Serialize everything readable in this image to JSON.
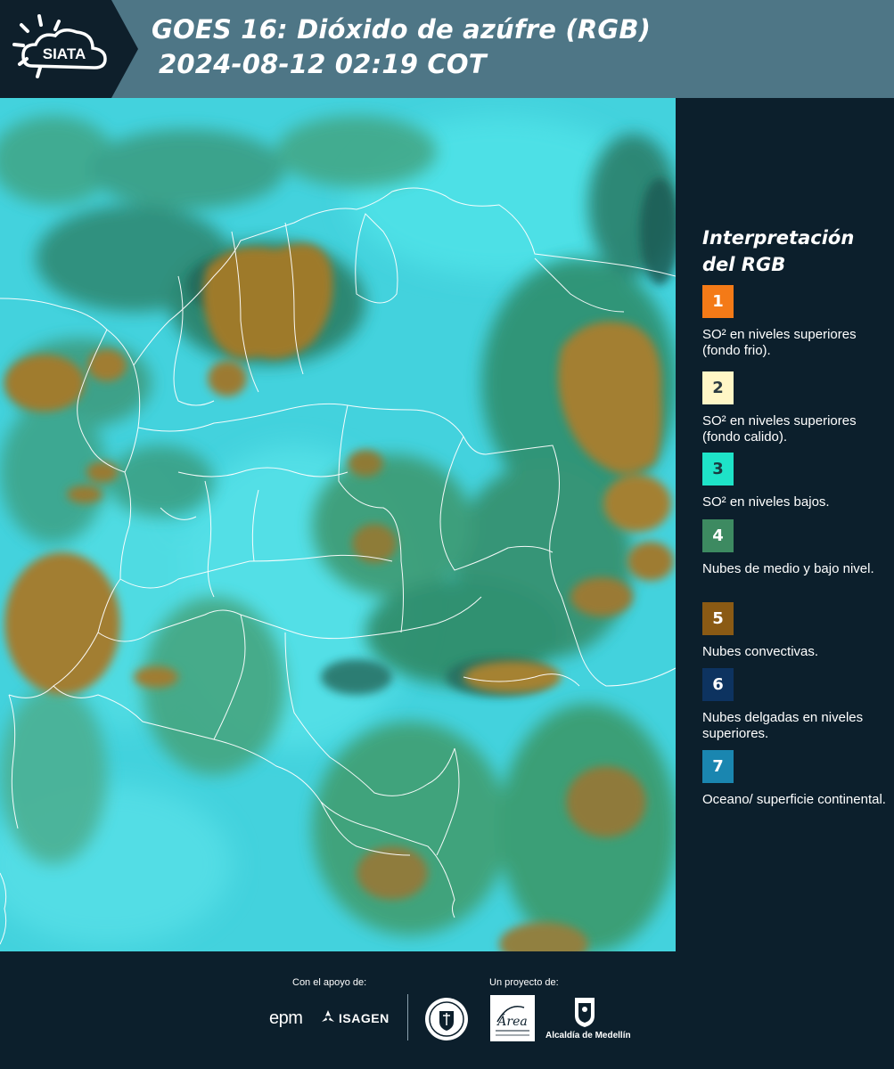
{
  "header": {
    "brand": "SIATA",
    "title_line1": "GOES 16: Dióxido de azúfre (RGB)",
    "title_line2": "2024-08-12 02:19 COT"
  },
  "legend": {
    "title_line1": "Interpretación",
    "title_line2": "del RGB",
    "items": [
      {
        "num": "1",
        "color": "#f47a17",
        "num_color": "#ffffff",
        "label": "SO² en niveles superiores (fondo frio)."
      },
      {
        "num": "2",
        "color": "#fff6c6",
        "num_color": "#2b3a40",
        "label": "SO² en niveles superiores (fondo calido)."
      },
      {
        "num": "3",
        "color": "#1ee3c8",
        "num_color": "#1a3a40",
        "label": "SO² en niveles bajos."
      },
      {
        "num": "4",
        "color": "#3d8a61",
        "num_color": "#ffffff",
        "label": "Nubes de medio y bajo nivel."
      },
      {
        "num": "5",
        "color": "#8a5a14",
        "num_color": "#ffffff",
        "label": "Nubes convectivas."
      },
      {
        "num": "6",
        "color": "#0d3360",
        "num_color": "#ffffff",
        "label": "Nubes delgadas en niveles superiores."
      },
      {
        "num": "7",
        "color": "#1a86b0",
        "num_color": "#ffffff",
        "label": "Oceano/ superficie continental."
      }
    ]
  },
  "footer": {
    "support_label": "Con el apoyo de:",
    "project_label": "Un proyecto de:",
    "epm": "epm",
    "isagen": "ISAGEN",
    "alcaldia": "Alcaldía de Medellín",
    "area_text": "Área"
  }
}
